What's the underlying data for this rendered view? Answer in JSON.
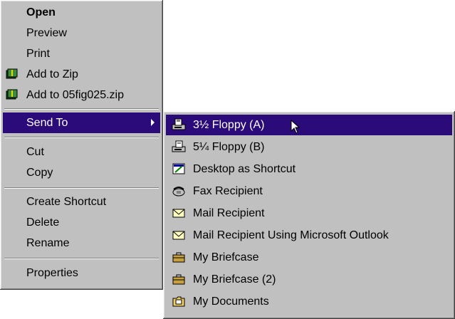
{
  "main_menu": {
    "items": [
      {
        "label": "Open"
      },
      {
        "label": "Preview"
      },
      {
        "label": "Print"
      },
      {
        "label": "Add to Zip",
        "icon": "winzip-icon"
      },
      {
        "label": "Add to 05fig025.zip",
        "icon": "winzip-icon"
      },
      {
        "label": "Send To"
      },
      {
        "label": "Cut"
      },
      {
        "label": "Copy"
      },
      {
        "label": "Create Shortcut"
      },
      {
        "label": "Delete"
      },
      {
        "label": "Rename"
      },
      {
        "label": "Properties"
      }
    ]
  },
  "send_to_menu": {
    "items": [
      {
        "label": "3½ Floppy (A)",
        "icon": "floppy-drive-icon"
      },
      {
        "label": "5¼ Floppy (B)",
        "icon": "floppy-drive-icon"
      },
      {
        "label": "Desktop as Shortcut",
        "icon": "desktop-shortcut-icon"
      },
      {
        "label": "Fax Recipient",
        "icon": "fax-icon"
      },
      {
        "label": "Mail Recipient",
        "icon": "mail-icon"
      },
      {
        "label": "Mail Recipient Using Microsoft Outlook",
        "icon": "mail-icon"
      },
      {
        "label": "My Briefcase",
        "icon": "briefcase-icon"
      },
      {
        "label": "My Briefcase (2)",
        "icon": "briefcase-icon"
      },
      {
        "label": "My Documents",
        "icon": "folder-icon"
      }
    ]
  },
  "colors": {
    "menu_face": "#c0c0c0",
    "highlight": "#2b0a7a",
    "highlight_text": "#ffffff"
  }
}
